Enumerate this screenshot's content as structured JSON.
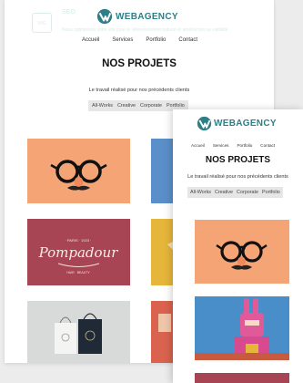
{
  "brand": {
    "name": "WEBAGENCY",
    "color": "#2d7f88"
  },
  "nav": [
    "Accueil",
    "Services",
    "Portfolio",
    "Contact"
  ],
  "section": {
    "title": "NOS PROJETS",
    "subtitle": "Le travail réalisé pour nos précédents clients"
  },
  "filters": [
    "All-Works",
    "Creative",
    "Corporate",
    "Portfolio"
  ],
  "banner": {
    "heading": "SEO",
    "text": "Nous optimisons votre site pour le référencement naturel et améliorons sa visibilité"
  },
  "portfolio": {
    "items": [
      {
        "name": "glasses-mustache",
        "bg": "#f5a476"
      },
      {
        "name": "blue-artwork",
        "bg": "#5b8fc9"
      },
      {
        "name": "pompadour",
        "bg": "#a84555",
        "text": "Pompadour"
      },
      {
        "name": "yellow-artwork",
        "bg": "#e6b63a"
      },
      {
        "name": "shopping-bags",
        "bg": "#d8dad9"
      },
      {
        "name": "red-artwork",
        "bg": "#d9634f"
      },
      {
        "name": "pink-bunny",
        "bg": "#4a8ec9"
      }
    ]
  }
}
